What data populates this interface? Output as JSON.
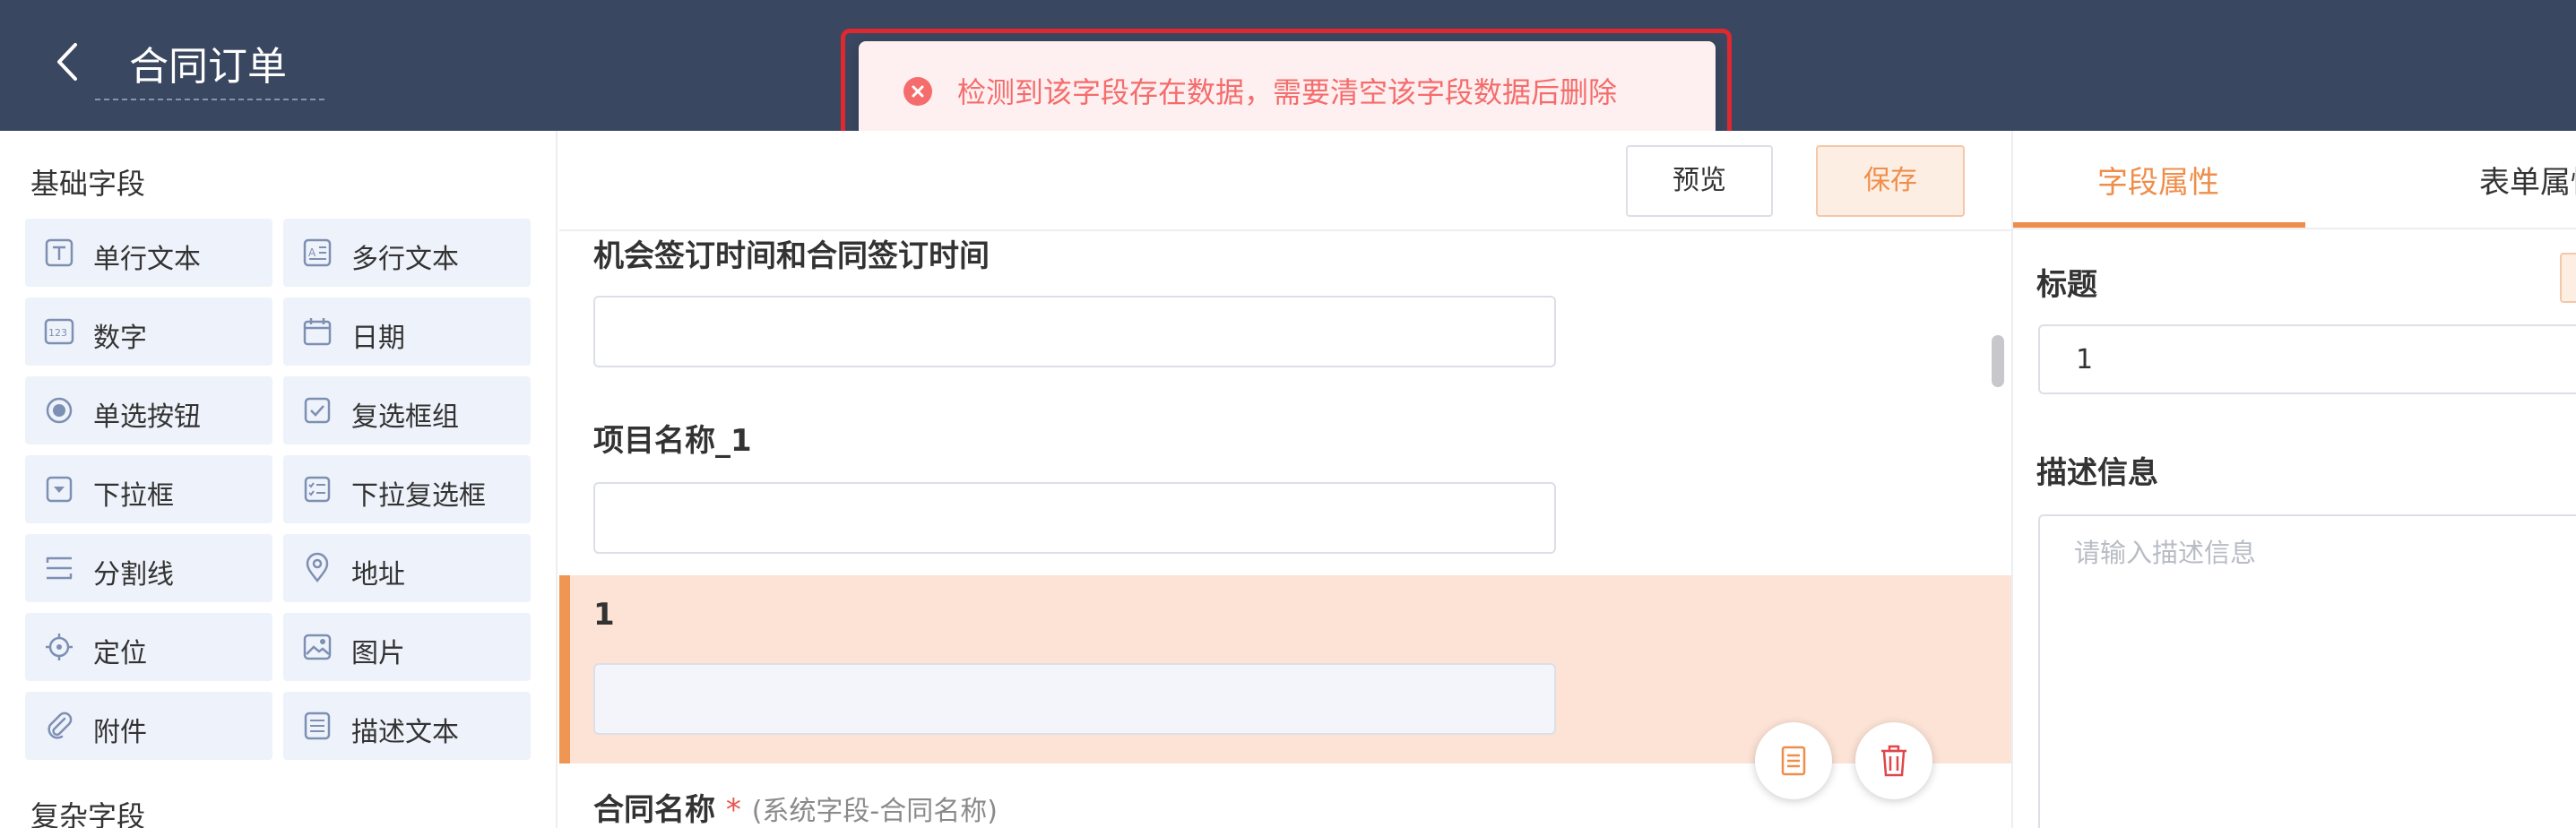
{
  "header": {
    "title": "合同订单"
  },
  "toast": {
    "message": "检测到该字段存在数据，需要清空该字段数据后删除",
    "type": "error"
  },
  "left_panel": {
    "basic_title": "基础字段",
    "complex_title": "复杂字段",
    "fields": [
      {
        "label": "单行文本",
        "icon": "single-line-text-icon"
      },
      {
        "label": "多行文本",
        "icon": "multi-line-text-icon"
      },
      {
        "label": "数字",
        "icon": "number-icon"
      },
      {
        "label": "日期",
        "icon": "calendar-icon"
      },
      {
        "label": "单选按钮",
        "icon": "radio-icon"
      },
      {
        "label": "复选框组",
        "icon": "checkbox-icon"
      },
      {
        "label": "下拉框",
        "icon": "dropdown-icon"
      },
      {
        "label": "下拉复选框",
        "icon": "dropdown-checklist-icon"
      },
      {
        "label": "分割线",
        "icon": "divider-icon"
      },
      {
        "label": "地址",
        "icon": "location-pin-icon"
      },
      {
        "label": "定位",
        "icon": "crosshair-icon"
      },
      {
        "label": "图片",
        "icon": "image-icon"
      },
      {
        "label": "附件",
        "icon": "paperclip-icon"
      },
      {
        "label": "描述文本",
        "icon": "description-text-icon"
      }
    ]
  },
  "center": {
    "preview_label": "预览",
    "save_label": "保存",
    "fields": [
      {
        "label": "机会签订时间和合同签订时间",
        "value": ""
      },
      {
        "label": "项目名称_1",
        "value": ""
      },
      {
        "label": "1",
        "value": "",
        "selected": true
      },
      {
        "label": "合同名称",
        "required_mark": "*",
        "hint": "(系统字段-合同名称)"
      }
    ]
  },
  "right_panel": {
    "tabs": [
      {
        "label": "字段属性",
        "active": true
      },
      {
        "label": "表单属性",
        "active": false
      }
    ],
    "title_label": "标题",
    "title_value": "1",
    "desc_label": "描述信息",
    "desc_placeholder": "请输入描述信息"
  },
  "colors": {
    "header_bg": "#3a4760",
    "accent": "#ef8e4b",
    "error": "#f56c6c",
    "selected_bg": "#fce3d5",
    "field_button_bg": "#eef2fa"
  }
}
